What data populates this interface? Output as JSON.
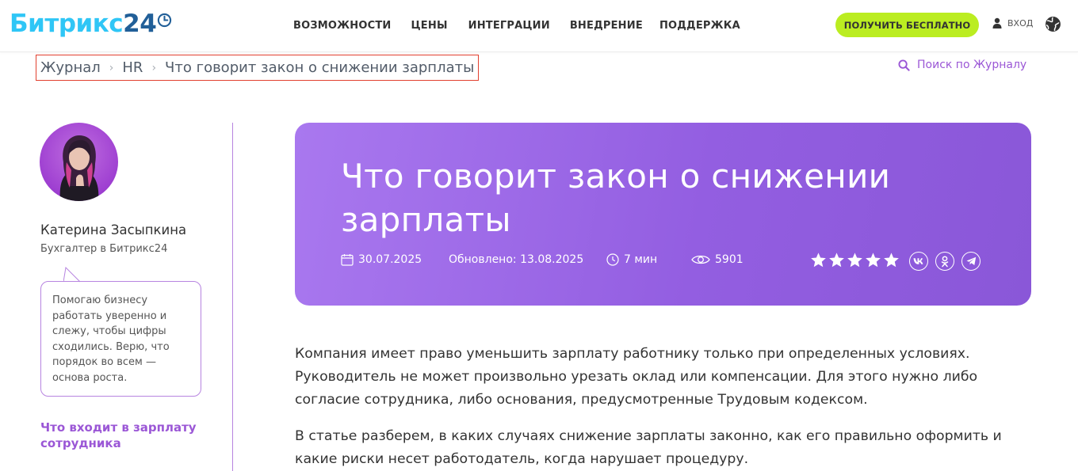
{
  "header": {
    "logo_brand": "Битрикс",
    "logo_num": "24",
    "nav": [
      "ВОЗМОЖНОСТИ",
      "ЦЕНЫ",
      "ИНТЕГРАЦИИ",
      "ВНЕДРЕНИЕ",
      "ПОДДЕРЖКА"
    ],
    "cta_label": "ПОЛУЧИТЬ БЕСПЛАТНО",
    "login_label": "ВХОД",
    "brand_color": "#2fc6f6",
    "cta_color": "#bbed21"
  },
  "breadcrumb": {
    "items": [
      "Журнал",
      "HR",
      "Что говорит закон о снижении зарплаты"
    ]
  },
  "search": {
    "label": "Поиск по Журналу",
    "icon": "search-icon"
  },
  "author": {
    "name": "Катерина Засыпкина",
    "role": "Бухгалтер в Битрикс24",
    "bio": "Помогаю бизнесу работать уверенно и слежу, чтобы цифры сходились. Верю, что порядок во всем — основа роста."
  },
  "toc": {
    "first_item": "Что входит в зарплату сотрудника"
  },
  "article": {
    "title": "Что говорит закон о снижении зарплаты",
    "date": "30.07.2025",
    "updated": "Обновлено: 13.08.2025",
    "read_time": "7 мин",
    "views": "5901",
    "rating": 5,
    "social_icons": [
      "vk-icon",
      "odnoklassniki-icon",
      "telegram-icon"
    ],
    "accent_color": "#9b57d6",
    "paragraphs": [
      "Компания имеет право уменьшить зарплату работнику только при определенных условиях. Руководитель не может произвольно урезать оклад или компенсации. Для этого нужно либо согласие сотрудника, либо основания, предусмотренные Трудовым кодексом.",
      "В статье разберем, в каких случаях снижение зарплаты законно, как его правильно оформить и какие риски несет работодатель, когда нарушает процедуру."
    ]
  }
}
